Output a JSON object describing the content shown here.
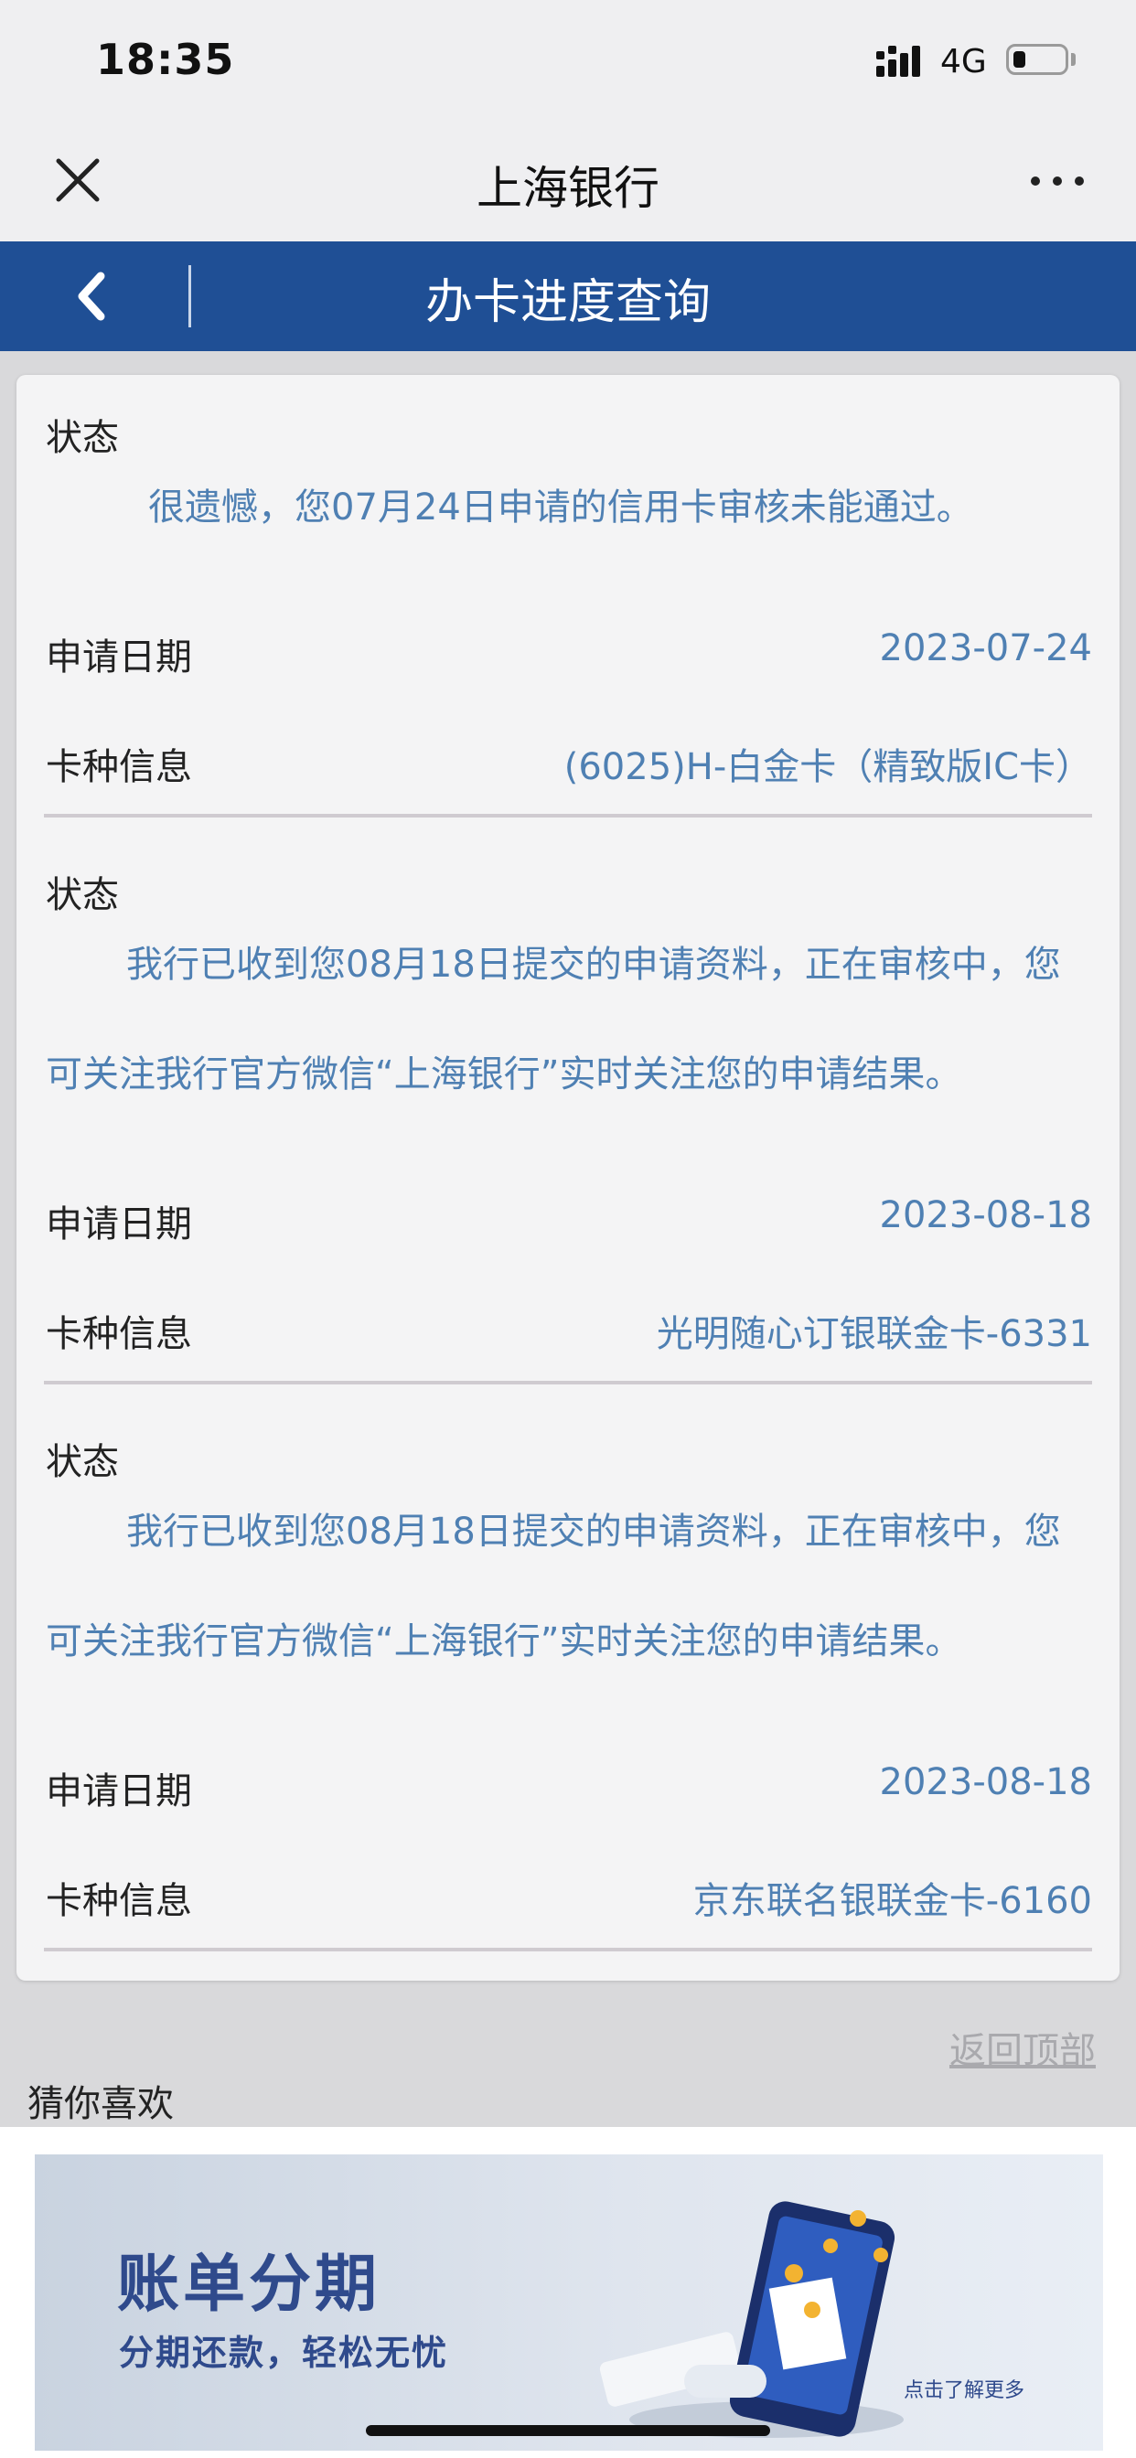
{
  "status_bar": {
    "time": "18:35",
    "network": "4G",
    "battery_level": 0.25
  },
  "wx_nav": {
    "title": "上海银行",
    "close_icon": "close-icon",
    "more_icon": "more-dots-icon"
  },
  "header": {
    "title": "办卡进度查询",
    "back_icon": "chevron-left-icon"
  },
  "records": [
    {
      "status_label": "状态",
      "message": "很遗憾，您07月24日申请的信用卡审核未能通过。",
      "date_label": "申请日期",
      "date": "2023-07-24",
      "card_label": "卡种信息",
      "card": "(6025)H-白金卡（精致版IC卡）"
    },
    {
      "status_label": "状态",
      "message_line1": "我行已收到您08月18日提交的申请资料，正在审核中，您",
      "message_line2": "可关注我行官方微信“上海银行”实时关注您的申请结果。",
      "date_label": "申请日期",
      "date": "2023-08-18",
      "card_label": "卡种信息",
      "card": "光明随心订银联金卡-6331"
    },
    {
      "status_label": "状态",
      "message_line1": "我行已收到您08月18日提交的申请资料，正在审核中，您",
      "message_line2": "可关注我行官方微信“上海银行”实时关注您的申请结果。",
      "date_label": "申请日期",
      "date": "2023-08-18",
      "card_label": "卡种信息",
      "card": "京东联名银联金卡-6160"
    }
  ],
  "back_to_top": "返回顶部",
  "recommend_title": "猜你喜欢",
  "banner": {
    "title": "账单分期",
    "subtitle": "分期还款，轻松无忧",
    "cta": "点击了解更多"
  },
  "colors": {
    "header_blue": "#1f4f95",
    "value_blue": "#4f80b3",
    "page_bg": "#d9d9db"
  }
}
